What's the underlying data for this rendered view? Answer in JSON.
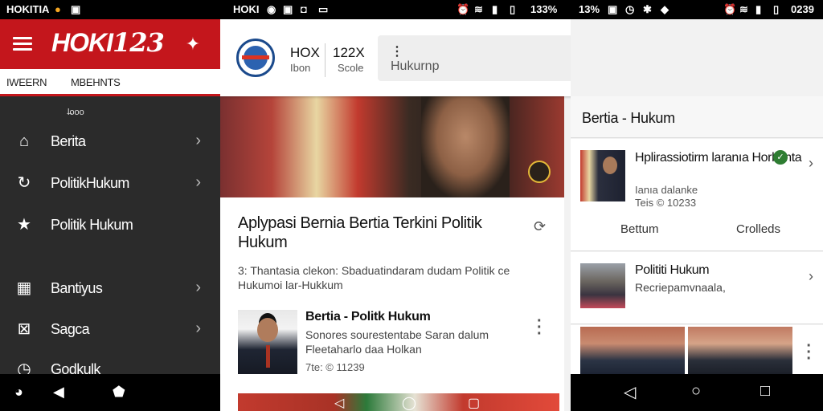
{
  "status_bar": {
    "left_app": "HOKITIA",
    "mid_app": "HOKI",
    "battery_a": "133%",
    "battery_b": "13%",
    "clock": "0239"
  },
  "left_panel": {
    "brand_text": "HOKI",
    "brand_number": "123",
    "tabs": [
      "IWEERN",
      "MBEHNTS"
    ],
    "caption": "l̶ooo",
    "items": [
      {
        "label": "Berita",
        "icon": "home-icon",
        "chevron": true
      },
      {
        "label": "PolitikHukum",
        "icon": "refresh-icon",
        "chevron": true
      },
      {
        "label": "Politik Hukum",
        "icon": "star-icon",
        "chevron": false
      },
      {
        "label": "Bantiyus",
        "icon": "puzzle-icon",
        "chevron": true
      },
      {
        "label": "Sagca",
        "icon": "resize-icon",
        "chevron": true
      },
      {
        "label": "Godkulk",
        "icon": "clock-icon",
        "chevron": false
      }
    ]
  },
  "middle_panel": {
    "brand": {
      "line1a": "HOX",
      "line1b": "122X",
      "line2a": "Ibon",
      "line2b": "Scole"
    },
    "search_placeholder": "Hukurnp",
    "article": {
      "title": "Aplypasi Bernia Bertia Terkini Politik Hukum",
      "excerpt": "3: Thantasia clekon: Sbaduatindaram dudam Politik ce Hukumoi lar-Hukkum"
    },
    "news_item": {
      "title": "Bertia - Politk Hukum",
      "text": "Sonores sourestentabe Saran dalum Fleetaharlo daa Holkan",
      "date": "7te: © 11239"
    }
  },
  "right_panel": {
    "header": "Bertia - Hukum",
    "card1": {
      "title": "Hplirassiotirm laranıa Horkanta",
      "sub1": "Ianıa dalanke",
      "sub2": "Teis © 10233",
      "btn_left": "Bettum",
      "btn_right": "Crolleds"
    },
    "card2": {
      "title": "Polititi Hukum",
      "sub": "Recriepamvnaala,"
    }
  },
  "colors": {
    "brand_red": "#c4161c",
    "drawer_bg": "#2b2b2b",
    "logo_blue": "#1b4a8c"
  }
}
